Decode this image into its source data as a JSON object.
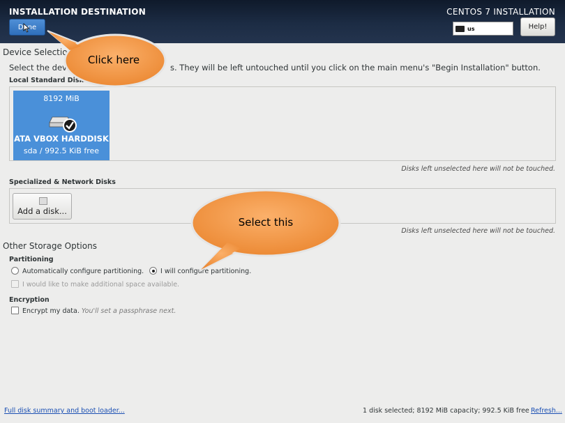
{
  "header": {
    "title": "INSTALLATION DESTINATION",
    "product": "CENTOS 7 INSTALLATION",
    "done_label": "Done",
    "keyboard_layout": "us",
    "help_label": "Help!"
  },
  "device_selection": {
    "title": "Device Selection",
    "instruction_start": "Select the dev",
    "instruction_end": "s.  They will be left untouched until you click on the main menu's \"Begin Installation\" button.",
    "local_title": "Local Standard Disks",
    "disk": {
      "size": "8192 MiB",
      "name": "ATA VBOX HARDDISK",
      "details": "sda  /  992.5 KiB free",
      "selected": true
    },
    "untouched_note": "Disks left unselected here will not be touched.",
    "network_title": "Specialized & Network Disks",
    "add_disk_label": "Add a disk...",
    "untouched_note_2": "Disks left unselected here will not be touched."
  },
  "storage_options": {
    "title": "Other Storage Options",
    "partitioning_title": "Partitioning",
    "auto_label": "Automatically configure partitioning.",
    "manual_label": "I will configure partitioning.",
    "selected": "manual",
    "extra_space_label": "I would like to make additional space available.",
    "encryption_title": "Encryption",
    "encrypt_label": "Encrypt my data.",
    "encrypt_note": "You'll set a passphrase next."
  },
  "footer": {
    "summary_link": "Full disk summary and boot loader...",
    "status": "1 disk selected; 8192 MiB capacity; 992.5 KiB free",
    "refresh_link": "Refresh..."
  },
  "callouts": {
    "click_here": "Click here",
    "select_this": "Select this",
    "color": "#f79646"
  }
}
